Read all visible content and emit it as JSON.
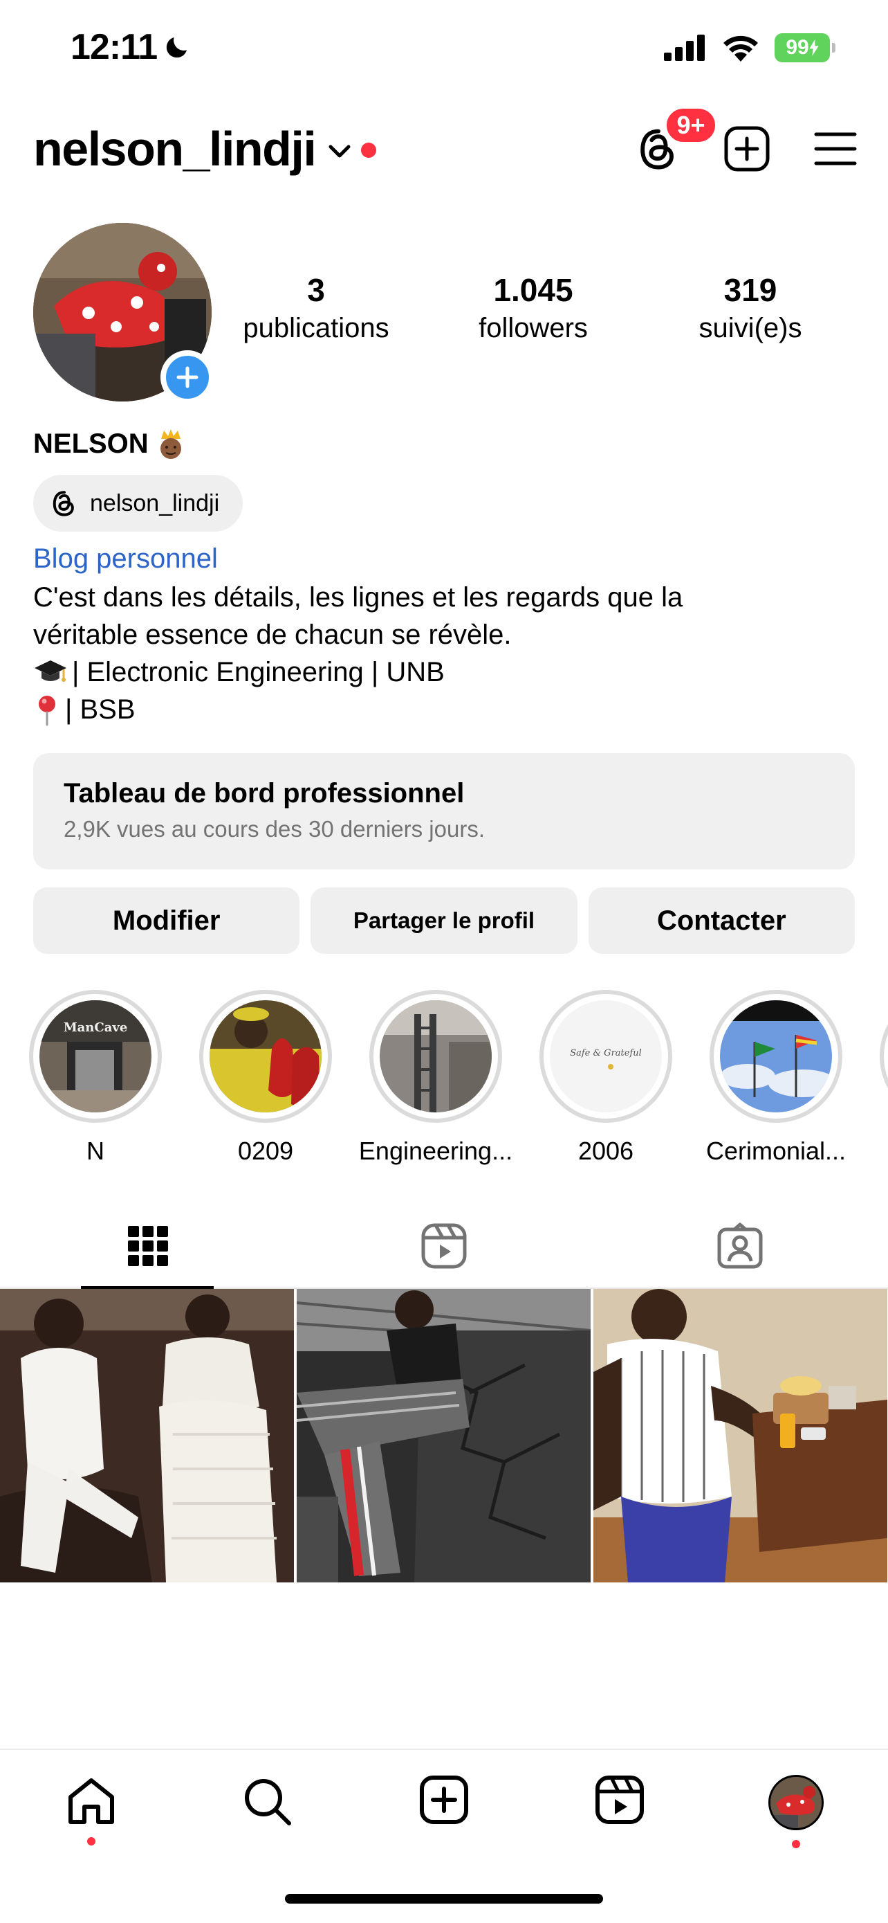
{
  "status_bar": {
    "time": "12:11",
    "battery": "99"
  },
  "header": {
    "username": "nelson_lindji",
    "notifications_badge": "9+"
  },
  "profile": {
    "stats": [
      {
        "value": "3",
        "label": "publications"
      },
      {
        "value": "1.045",
        "label": "followers"
      },
      {
        "value": "319",
        "label": "suivi(e)s"
      }
    ],
    "display_name": "NELSON",
    "threads_handle": "nelson_lindji",
    "category": "Blog personnel",
    "bio_lines": [
      "C'est dans les détails, les lignes et les regards que la",
      "véritable essence de chacun se révèle.",
      "| Electronic Engineering | UNB",
      "| BSB"
    ]
  },
  "dashboard": {
    "title": "Tableau de bord professionnel",
    "subtitle": "2,9K vues au cours des 30 derniers jours."
  },
  "actions": {
    "edit": "Modifier",
    "share": "Partager le profil",
    "contact": "Contacter"
  },
  "highlights": [
    {
      "label": "N",
      "image_text": "ManCave"
    },
    {
      "label": "0209"
    },
    {
      "label": "Engineering..."
    },
    {
      "label": "2006",
      "image_text": "Safe & Grateful"
    },
    {
      "label": "Cerimonial..."
    }
  ],
  "tabs": [
    "posts-grid",
    "reels",
    "tagged"
  ],
  "colors": {
    "accent_blue": "#3797f0",
    "link_blue": "#2d64c8",
    "notification_red": "#ff3040",
    "battery_green": "#5fd35c",
    "button_bg": "#efefef"
  }
}
